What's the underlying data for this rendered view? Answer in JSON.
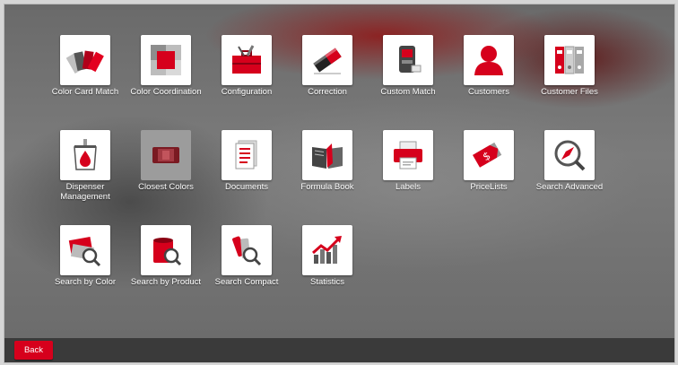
{
  "tiles": [
    {
      "label": "Color Card Match",
      "icon": "color-fan-icon"
    },
    {
      "label": "Color Coordination",
      "icon": "color-swatch-icon"
    },
    {
      "label": "Configuration",
      "icon": "toolbox-icon"
    },
    {
      "label": "Correction",
      "icon": "eraser-icon"
    },
    {
      "label": "Custom Match",
      "icon": "spectrophotometer-icon"
    },
    {
      "label": "Customers",
      "icon": "person-icon"
    },
    {
      "label": "Customer Files",
      "icon": "binders-icon"
    },
    {
      "label": "Dispenser Management",
      "icon": "dispenser-can-icon"
    },
    {
      "label": "Closest Colors",
      "icon": "closest-colors-icon"
    },
    {
      "label": "Documents",
      "icon": "document-icon"
    },
    {
      "label": "Formula Book",
      "icon": "open-book-icon"
    },
    {
      "label": "Labels",
      "icon": "printer-icon"
    },
    {
      "label": "PriceLists",
      "icon": "price-tag-icon"
    },
    {
      "label": "Search Advanced",
      "icon": "compass-search-icon"
    },
    {
      "label": "Search by Color",
      "icon": "card-search-icon"
    },
    {
      "label": "Search by Product",
      "icon": "paint-can-search-icon"
    },
    {
      "label": "Search Compact",
      "icon": "compact-search-icon"
    },
    {
      "label": "Statistics",
      "icon": "bar-chart-icon"
    }
  ],
  "footer": {
    "back_label": "Back"
  },
  "colors": {
    "accent": "#d6001c",
    "footer": "#3a3a3a"
  }
}
